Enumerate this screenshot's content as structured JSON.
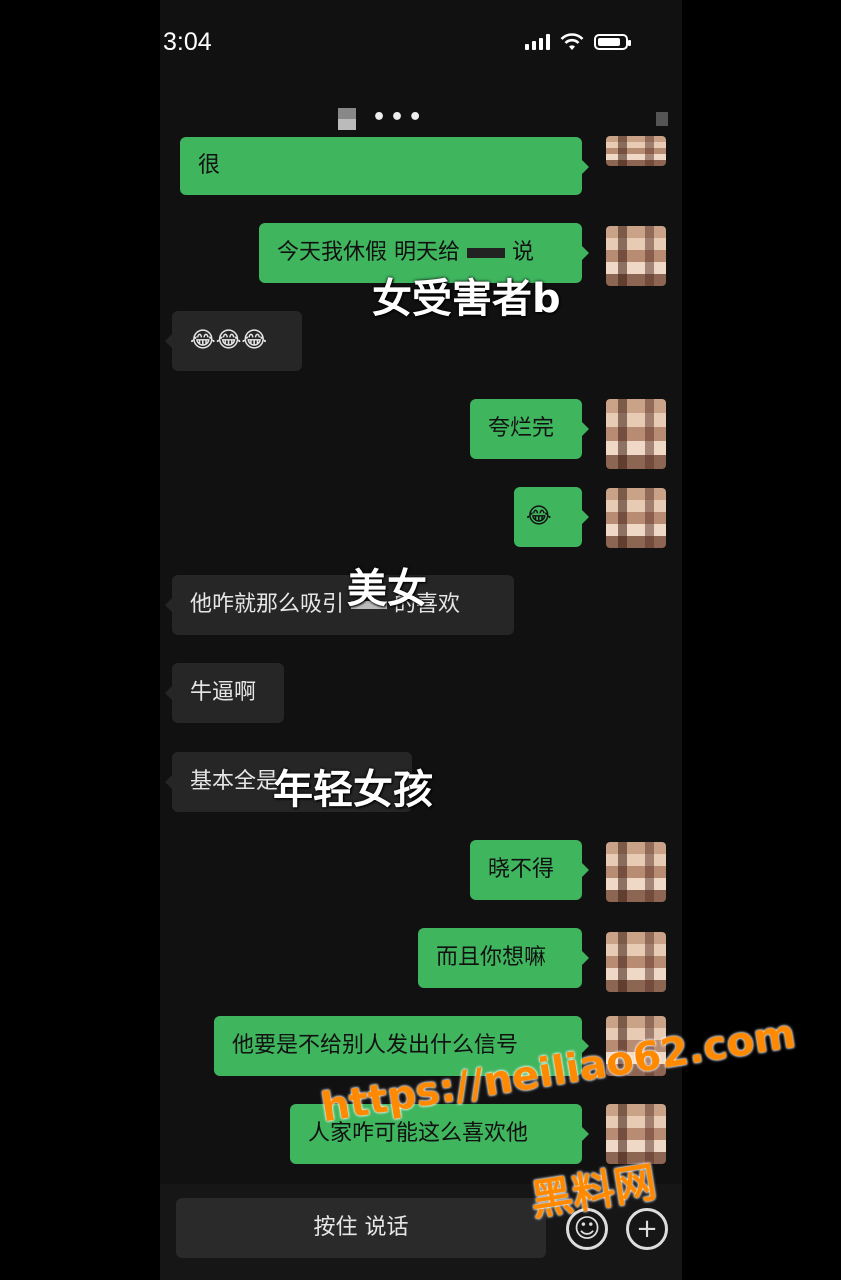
{
  "status_bar": {
    "time": "3:04",
    "signal_icon": "signal-icon",
    "wifi_icon": "wifi-icon",
    "battery_icon": "battery-icon"
  },
  "header": {
    "title_masked": "•••"
  },
  "messages": [
    {
      "side": "me",
      "text": "很"
    },
    {
      "side": "me",
      "text": "今天我休假 明天给",
      "text_after": "说"
    },
    {
      "side": "other",
      "text": "😂😂😂"
    },
    {
      "side": "me",
      "text": "夸烂完"
    },
    {
      "side": "me",
      "text": "😂"
    },
    {
      "side": "other",
      "text": "他咋就那么吸引",
      "text_after": "的喜欢"
    },
    {
      "side": "other",
      "text": "牛逼啊"
    },
    {
      "side": "other",
      "text": "基本全是"
    },
    {
      "side": "me",
      "text": "晓不得"
    },
    {
      "side": "me",
      "text": "而且你想嘛"
    },
    {
      "side": "me",
      "text": "他要是不给别人发出什么信号"
    },
    {
      "side": "me",
      "text": "人家咋可能这么喜欢他"
    }
  ],
  "overlays": {
    "victim_b": "女受害者b",
    "beauty": "美女",
    "young_girl": "年轻女孩"
  },
  "input_bar": {
    "voice_label": "按住 说话",
    "emoji_icon": "emoji-icon",
    "plus_icon": "plus-icon"
  },
  "watermark": {
    "url": "https://neiliao62.com",
    "name": "黑料网"
  },
  "colors": {
    "me_bubble": "#3fb55e",
    "other_bubble": "#262626",
    "watermark": "#ff8a00"
  }
}
